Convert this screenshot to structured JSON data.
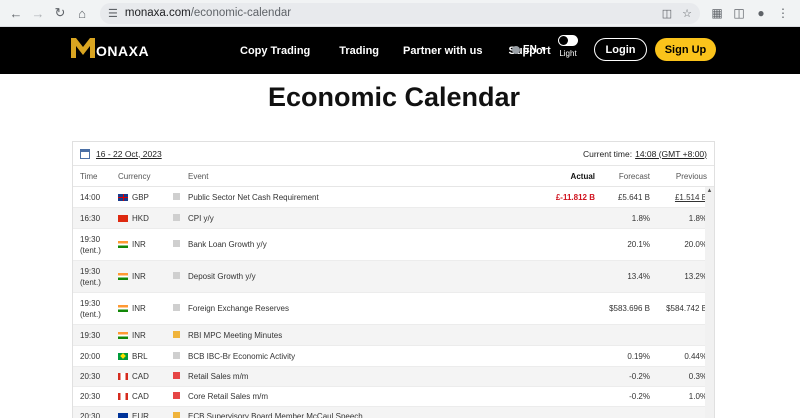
{
  "browser": {
    "url_host": "monaxa.com",
    "url_path": "/economic-calendar"
  },
  "header": {
    "logo_text": "ONAXA",
    "nav": [
      "Copy Trading",
      "Trading",
      "Partner with us",
      "Support"
    ],
    "language": "EN",
    "theme_label": "Light",
    "login_label": "Login",
    "signup_label": "Sign Up",
    "accent_color": "#fac31b"
  },
  "page": {
    "title": "Economic Calendar"
  },
  "calendar": {
    "date_range": "16 - 22 Oct, 2023",
    "current_time_label": "Current time:",
    "current_time_value": "14:08 (GMT +8:00)",
    "columns": {
      "time": "Time",
      "currency": "Currency",
      "event": "Event",
      "actual": "Actual",
      "forecast": "Forecast",
      "previous": "Previous"
    },
    "rows": [
      {
        "time": "14:00",
        "tent": "",
        "currency": "GBP",
        "flag": "gbp",
        "importance": "low",
        "event": "Public Sector Net Cash Requirement",
        "actual": "£-11.812 B",
        "forecast": "£5.641 B",
        "previous": "£1.514 B"
      },
      {
        "time": "16:30",
        "tent": "",
        "currency": "HKD",
        "flag": "hkd",
        "importance": "low",
        "event": "CPI y/y",
        "actual": "",
        "forecast": "1.8%",
        "previous": "1.8%"
      },
      {
        "time": "19:30",
        "tent": "(tent.)",
        "currency": "INR",
        "flag": "inr",
        "importance": "low",
        "event": "Bank Loan Growth y/y",
        "actual": "",
        "forecast": "20.1%",
        "previous": "20.0%"
      },
      {
        "time": "19:30",
        "tent": "(tent.)",
        "currency": "INR",
        "flag": "inr",
        "importance": "low",
        "event": "Deposit Growth y/y",
        "actual": "",
        "forecast": "13.4%",
        "previous": "13.2%"
      },
      {
        "time": "19:30",
        "tent": "(tent.)",
        "currency": "INR",
        "flag": "inr",
        "importance": "low",
        "event": "Foreign Exchange Reserves",
        "actual": "",
        "forecast": "$583.696 B",
        "previous": "$584.742 B"
      },
      {
        "time": "19:30",
        "tent": "",
        "currency": "INR",
        "flag": "inr",
        "importance": "mid",
        "event": "RBI MPC Meeting Minutes",
        "actual": "",
        "forecast": "",
        "previous": ""
      },
      {
        "time": "20:00",
        "tent": "",
        "currency": "BRL",
        "flag": "brl",
        "importance": "low",
        "event": "BCB IBC-Br Economic Activity",
        "actual": "",
        "forecast": "0.19%",
        "previous": "0.44%"
      },
      {
        "time": "20:30",
        "tent": "",
        "currency": "CAD",
        "flag": "cad",
        "importance": "high",
        "event": "Retail Sales m/m",
        "actual": "",
        "forecast": "-0.2%",
        "previous": "0.3%"
      },
      {
        "time": "20:30",
        "tent": "",
        "currency": "CAD",
        "flag": "cad",
        "importance": "high",
        "event": "Core Retail Sales m/m",
        "actual": "",
        "forecast": "-0.2%",
        "previous": "1.0%"
      },
      {
        "time": "20:30",
        "tent": "",
        "currency": "EUR",
        "flag": "eur",
        "importance": "mid",
        "event": "ECB Supervisory Board Member McCaul Speech",
        "actual": "",
        "forecast": "",
        "previous": ""
      }
    ]
  }
}
